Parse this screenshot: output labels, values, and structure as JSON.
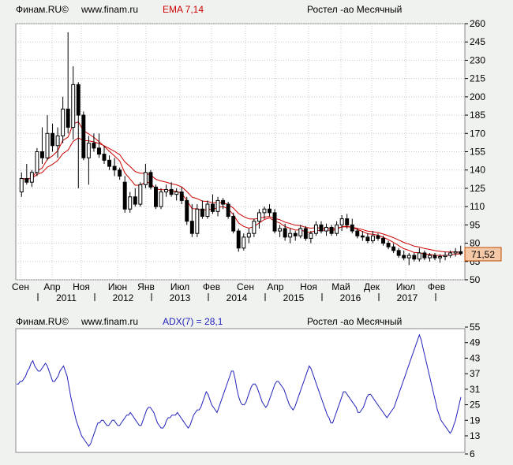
{
  "colors": {
    "background": "#f0f2ef",
    "plot_background": "#ffffff",
    "grid": "#c8c8c8",
    "axis": "#000000",
    "ema": "#cc0000",
    "adx": "#2222bb",
    "last_price_bg": "#f5c9a8",
    "last_price_border": "#c04a00"
  },
  "main_header": {
    "brand": "Финам.RU©",
    "site": "www.finam.ru",
    "indicator": "EMA 7,14",
    "instrument": "Ростел -ао Месячный"
  },
  "adx_header": {
    "brand": "Финам.RU©",
    "site": "www.finam.ru",
    "indicator": "ADX(7) = 28,1",
    "instrument": "Ростел -ао Месячный"
  },
  "last_price_label": "71,52",
  "chart_data": [
    {
      "type": "candlestick",
      "ylim": [
        50,
        260
      ],
      "y_ticks": [
        "260",
        "245",
        "230",
        "215",
        "200",
        "185",
        "170",
        "155",
        "140",
        "125",
        "110",
        "95",
        "80",
        "65",
        "50"
      ],
      "month_labels": [
        "Сен",
        "Апр",
        "Ноя",
        "Июн",
        "Янв",
        "Июл",
        "Фев",
        "Сен",
        "Апр",
        "Ноя",
        "Май",
        "Дек",
        "Июл",
        "Фев"
      ],
      "year_labels": [
        "2011",
        "2012",
        "2013",
        "2014",
        "2015",
        "2016",
        "2017"
      ],
      "candles": [
        {
          "o": 122,
          "h": 138,
          "l": 118,
          "c": 133
        },
        {
          "o": 133,
          "h": 145,
          "l": 128,
          "c": 130
        },
        {
          "o": 130,
          "h": 140,
          "l": 126,
          "c": 138
        },
        {
          "o": 138,
          "h": 158,
          "l": 135,
          "c": 155
        },
        {
          "o": 155,
          "h": 175,
          "l": 145,
          "c": 150
        },
        {
          "o": 150,
          "h": 185,
          "l": 148,
          "c": 170
        },
        {
          "o": 170,
          "h": 178,
          "l": 155,
          "c": 160
        },
        {
          "o": 160,
          "h": 175,
          "l": 150,
          "c": 168
        },
        {
          "o": 168,
          "h": 200,
          "l": 162,
          "c": 190
        },
        {
          "o": 190,
          "h": 253,
          "l": 170,
          "c": 175
        },
        {
          "o": 175,
          "h": 225,
          "l": 165,
          "c": 210
        },
        {
          "o": 210,
          "h": 212,
          "l": 125,
          "c": 185
        },
        {
          "o": 185,
          "h": 188,
          "l": 148,
          "c": 150
        },
        {
          "o": 150,
          "h": 168,
          "l": 128,
          "c": 162
        },
        {
          "o": 162,
          "h": 170,
          "l": 155,
          "c": 158
        },
        {
          "o": 158,
          "h": 170,
          "l": 150,
          "c": 153
        },
        {
          "o": 153,
          "h": 160,
          "l": 145,
          "c": 148
        },
        {
          "o": 148,
          "h": 152,
          "l": 140,
          "c": 143
        },
        {
          "o": 143,
          "h": 150,
          "l": 135,
          "c": 140
        },
        {
          "o": 140,
          "h": 142,
          "l": 132,
          "c": 135
        },
        {
          "o": 130,
          "h": 135,
          "l": 105,
          "c": 108
        },
        {
          "o": 108,
          "h": 122,
          "l": 105,
          "c": 118
        },
        {
          "o": 118,
          "h": 125,
          "l": 110,
          "c": 112
        },
        {
          "o": 112,
          "h": 130,
          "l": 110,
          "c": 128
        },
        {
          "o": 128,
          "h": 145,
          "l": 125,
          "c": 138
        },
        {
          "o": 138,
          "h": 140,
          "l": 124,
          "c": 126
        },
        {
          "o": 126,
          "h": 128,
          "l": 108,
          "c": 110
        },
        {
          "o": 110,
          "h": 125,
          "l": 108,
          "c": 122
        },
        {
          "o": 122,
          "h": 128,
          "l": 118,
          "c": 124
        },
        {
          "o": 124,
          "h": 130,
          "l": 118,
          "c": 120
        },
        {
          "o": 120,
          "h": 125,
          "l": 115,
          "c": 122
        },
        {
          "o": 122,
          "h": 126,
          "l": 112,
          "c": 115
        },
        {
          "o": 115,
          "h": 118,
          "l": 95,
          "c": 98
        },
        {
          "o": 98,
          "h": 112,
          "l": 85,
          "c": 88
        },
        {
          "o": 88,
          "h": 112,
          "l": 85,
          "c": 108
        },
        {
          "o": 108,
          "h": 115,
          "l": 100,
          "c": 102
        },
        {
          "o": 102,
          "h": 115,
          "l": 100,
          "c": 112
        },
        {
          "o": 112,
          "h": 120,
          "l": 104,
          "c": 106
        },
        {
          "o": 106,
          "h": 118,
          "l": 102,
          "c": 115
        },
        {
          "o": 115,
          "h": 117,
          "l": 108,
          "c": 112
        },
        {
          "o": 112,
          "h": 114,
          "l": 100,
          "c": 102
        },
        {
          "o": 102,
          "h": 105,
          "l": 88,
          "c": 90
        },
        {
          "o": 90,
          "h": 92,
          "l": 73,
          "c": 76
        },
        {
          "o": 76,
          "h": 88,
          "l": 74,
          "c": 85
        },
        {
          "o": 85,
          "h": 92,
          "l": 80,
          "c": 88
        },
        {
          "o": 88,
          "h": 100,
          "l": 85,
          "c": 98
        },
        {
          "o": 98,
          "h": 108,
          "l": 92,
          "c": 105
        },
        {
          "o": 105,
          "h": 110,
          "l": 100,
          "c": 108
        },
        {
          "o": 108,
          "h": 112,
          "l": 102,
          "c": 105
        },
        {
          "o": 105,
          "h": 108,
          "l": 88,
          "c": 90
        },
        {
          "o": 90,
          "h": 95,
          "l": 85,
          "c": 92
        },
        {
          "o": 92,
          "h": 96,
          "l": 82,
          "c": 85
        },
        {
          "o": 85,
          "h": 92,
          "l": 80,
          "c": 88
        },
        {
          "o": 88,
          "h": 90,
          "l": 82,
          "c": 86
        },
        {
          "o": 86,
          "h": 95,
          "l": 84,
          "c": 92
        },
        {
          "o": 92,
          "h": 94,
          "l": 82,
          "c": 84
        },
        {
          "o": 84,
          "h": 90,
          "l": 80,
          "c": 88
        },
        {
          "o": 88,
          "h": 98,
          "l": 86,
          "c": 95
        },
        {
          "o": 95,
          "h": 98,
          "l": 88,
          "c": 90
        },
        {
          "o": 90,
          "h": 96,
          "l": 86,
          "c": 93
        },
        {
          "o": 93,
          "h": 95,
          "l": 86,
          "c": 88
        },
        {
          "o": 88,
          "h": 98,
          "l": 86,
          "c": 95
        },
        {
          "o": 95,
          "h": 103,
          "l": 90,
          "c": 100
        },
        {
          "o": 100,
          "h": 104,
          "l": 92,
          "c": 95
        },
        {
          "o": 95,
          "h": 100,
          "l": 88,
          "c": 90
        },
        {
          "o": 90,
          "h": 92,
          "l": 84,
          "c": 86
        },
        {
          "o": 86,
          "h": 90,
          "l": 82,
          "c": 85
        },
        {
          "o": 85,
          "h": 88,
          "l": 80,
          "c": 82
        },
        {
          "o": 82,
          "h": 90,
          "l": 80,
          "c": 86
        },
        {
          "o": 86,
          "h": 88,
          "l": 82,
          "c": 84
        },
        {
          "o": 84,
          "h": 86,
          "l": 78,
          "c": 80
        },
        {
          "o": 80,
          "h": 82,
          "l": 75,
          "c": 77
        },
        {
          "o": 77,
          "h": 80,
          "l": 72,
          "c": 74
        },
        {
          "o": 74,
          "h": 76,
          "l": 68,
          "c": 70
        },
        {
          "o": 70,
          "h": 74,
          "l": 66,
          "c": 68
        },
        {
          "o": 68,
          "h": 72,
          "l": 62,
          "c": 70
        },
        {
          "o": 70,
          "h": 72,
          "l": 65,
          "c": 67
        },
        {
          "o": 67,
          "h": 76,
          "l": 65,
          "c": 72
        },
        {
          "o": 72,
          "h": 74,
          "l": 66,
          "c": 68
        },
        {
          "o": 68,
          "h": 72,
          "l": 65,
          "c": 70
        },
        {
          "o": 70,
          "h": 72,
          "l": 66,
          "c": 68
        },
        {
          "o": 68,
          "h": 71,
          "l": 64,
          "c": 69
        },
        {
          "o": 69,
          "h": 73,
          "l": 66,
          "c": 70
        },
        {
          "o": 70,
          "h": 74,
          "l": 68,
          "c": 72
        },
        {
          "o": 72,
          "h": 76,
          "l": 69,
          "c": 73
        },
        {
          "o": 73,
          "h": 78,
          "l": 70,
          "c": 71.52
        }
      ]
    },
    {
      "type": "line",
      "series_name": "ADX(7)",
      "ylim": [
        6,
        55
      ],
      "y_ticks": [
        "55",
        "49",
        "43",
        "37",
        "31",
        "25",
        "19",
        "13",
        "6"
      ],
      "values": [
        33,
        33,
        34,
        34,
        35,
        36,
        38,
        39,
        41,
        42,
        40,
        39,
        38,
        38,
        39,
        40,
        41,
        40,
        38,
        36,
        34,
        34,
        35,
        36,
        38,
        39,
        40,
        38,
        36,
        32,
        28,
        25,
        22,
        19,
        17,
        15,
        13,
        12,
        11,
        10,
        9,
        10,
        12,
        14,
        16,
        18,
        18,
        19,
        19,
        18,
        17,
        17,
        18,
        19,
        19,
        18,
        17,
        17,
        18,
        19,
        20,
        21,
        21,
        22,
        21,
        20,
        19,
        18,
        17,
        17,
        19,
        21,
        23,
        24,
        24,
        23,
        22,
        20,
        18,
        17,
        16,
        16,
        17,
        19,
        20,
        20,
        21,
        21,
        21,
        22,
        21,
        20,
        19,
        18,
        17,
        16,
        17,
        19,
        21,
        22,
        23,
        23,
        24,
        26,
        28,
        30,
        29,
        27,
        25,
        24,
        23,
        22,
        24,
        26,
        28,
        30,
        32,
        34,
        36,
        38,
        38,
        35,
        31,
        28,
        26,
        25,
        25,
        26,
        28,
        30,
        32,
        33,
        33,
        32,
        30,
        28,
        26,
        25,
        24,
        25,
        27,
        29,
        31,
        33,
        34,
        34,
        33,
        32,
        31,
        29,
        27,
        25,
        24,
        23,
        24,
        26,
        28,
        30,
        32,
        34,
        36,
        38,
        40,
        39,
        37,
        35,
        33,
        31,
        29,
        27,
        25,
        23,
        21,
        20,
        18,
        18,
        20,
        22,
        24,
        26,
        28,
        30,
        30,
        29,
        28,
        27,
        26,
        25,
        24,
        22,
        22,
        23,
        24,
        26,
        28,
        29,
        29,
        28,
        27,
        26,
        25,
        24,
        23,
        22,
        21,
        20,
        21,
        22,
        23,
        24,
        26,
        28,
        30,
        32,
        34,
        36,
        38,
        40,
        42,
        44,
        46,
        48,
        50,
        52,
        50,
        47,
        44,
        41,
        38,
        35,
        32,
        29,
        26,
        23,
        21,
        19,
        18,
        17,
        16,
        15,
        14,
        15,
        17,
        19,
        22,
        25,
        28
      ]
    }
  ]
}
